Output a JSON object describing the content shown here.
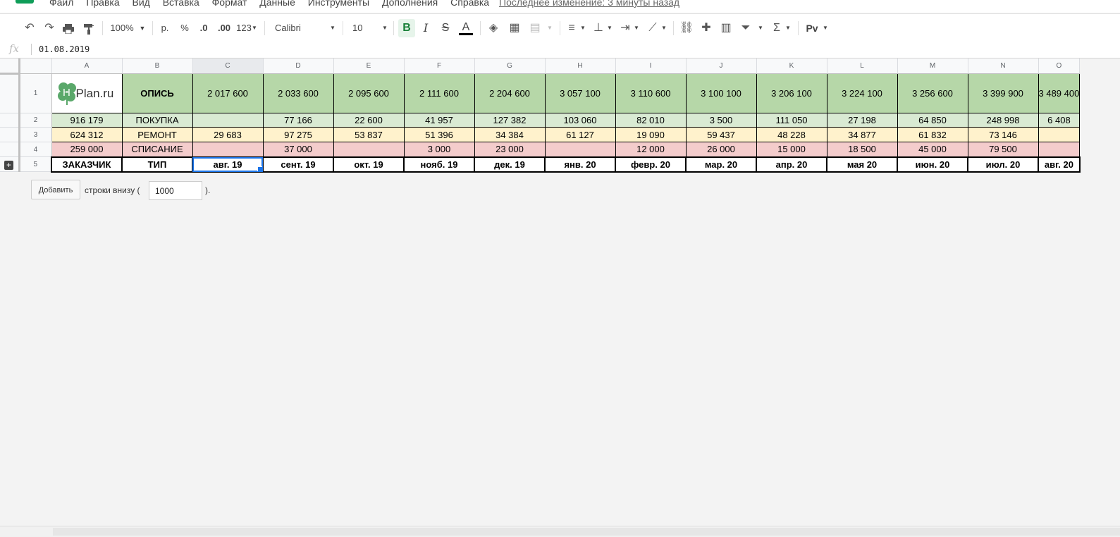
{
  "menu": {
    "items": [
      "Файл",
      "Правка",
      "Вид",
      "Вставка",
      "Формат",
      "Данные",
      "Инструменты",
      "Дополнения",
      "Справка"
    ],
    "last_edit": "Последнее изменение: 3 минуты назад"
  },
  "toolbar": {
    "zoom": "100%",
    "currency": "р.",
    "percent": "%",
    "dec_decrease": ".0",
    "dec_increase": ".00",
    "format_more": "123",
    "font": "Calibri",
    "font_size": "10",
    "bold": "B",
    "italic": "I",
    "strike": "S",
    "text_color": "A",
    "script": "Pv"
  },
  "formula_bar": {
    "fx": "fx",
    "value": "01.08.2019"
  },
  "columns": [
    "A",
    "B",
    "C",
    "D",
    "E",
    "F",
    "G",
    "H",
    "I",
    "J",
    "K",
    "L",
    "M",
    "N",
    "O"
  ],
  "rows": [
    {
      "num": "1",
      "logo": {
        "letter": "H",
        "text": "Plan.ru"
      },
      "b": "ОПИСЬ",
      "values": [
        "2 017 600",
        "2 033 600",
        "2 095 600",
        "2 111 600",
        "2 204 600",
        "3 057 100",
        "3 110 600",
        "3 100 100",
        "3 206 100",
        "3 224 100",
        "3 256 600",
        "3 399 900",
        "3 489 400"
      ]
    },
    {
      "num": "2",
      "a": "916 179",
      "b": "ПОКУПКА",
      "values": [
        "",
        "77 166",
        "22 600",
        "41 957",
        "127 382",
        "103 060",
        "82 010",
        "3 500",
        "111 050",
        "27 198",
        "64 850",
        "248 998",
        "6 408"
      ]
    },
    {
      "num": "3",
      "a": "624 312",
      "b": "РЕМОНТ",
      "values": [
        "29 683",
        "97 275",
        "53 837",
        "51 396",
        "34 384",
        "61 127",
        "19 090",
        "59 437",
        "48 228",
        "34 877",
        "61 832",
        "73 146",
        ""
      ]
    },
    {
      "num": "4",
      "a": "259 000",
      "b": "СПИСАНИЕ",
      "values": [
        "",
        "37 000",
        "",
        "3 000",
        "23 000",
        "",
        "12 000",
        "26 000",
        "15 000",
        "18 500",
        "45 000",
        "79 500",
        ""
      ]
    },
    {
      "num": "5",
      "a": "ЗАКАЗЧИК",
      "b": "ТИП",
      "values": [
        "авг. 19",
        "сент. 19",
        "окт. 19",
        "нояб. 19",
        "дек. 19",
        "янв. 20",
        "февр. 20",
        "мар. 20",
        "апр. 20",
        "мая 20",
        "июн. 20",
        "июл. 20",
        "авг. 20"
      ]
    }
  ],
  "add_rows": {
    "button": "Добавить",
    "text": "строки внизу (",
    "value": "1000",
    "close": ")."
  },
  "colors": {
    "header_green": "#b6d7a8",
    "light_green": "#d9ead3",
    "yellow": "#fff2cc",
    "red": "#f4cccc",
    "selection": "#1a73e8"
  }
}
